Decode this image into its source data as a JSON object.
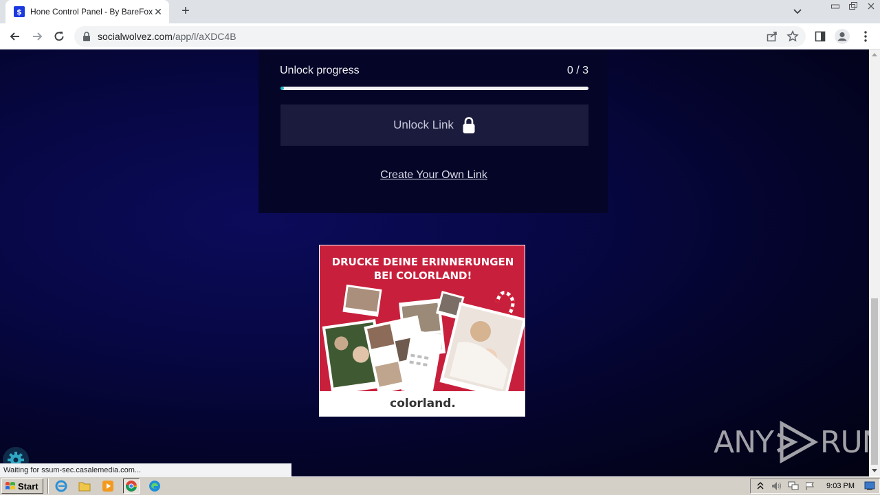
{
  "browser": {
    "tab": {
      "title": "Hone Control Panel - By BareFox",
      "favicon_glyph": "$"
    },
    "address": {
      "host": "socialwolvez.com",
      "path": "/app/l/aXDC4B"
    },
    "colors": {
      "tab_favicon": "#1a3ae0"
    }
  },
  "page": {
    "progress": {
      "label": "Unlock progress",
      "count": "0 / 3",
      "completed": 0,
      "total": 3
    },
    "unlock_button_label": "Unlock Link",
    "create_link_label": "Create Your Own Link",
    "ad": {
      "headline_line1": "DRUCKE DEINE ERINNERUNGEN",
      "headline_line2": "BEI COLORLAND!",
      "brand": "colorland."
    },
    "watermark_left": "ANY",
    "watermark_right": "RUN",
    "colors": {
      "background": "#04042a",
      "card": "#050528",
      "button": "#1b1b3d",
      "progress_fill": "#1fb5c8",
      "ad_red": "#c8203c"
    }
  },
  "status_bar": {
    "text": "Waiting for ssum-sec.casalemedia.com..."
  },
  "taskbar": {
    "start_label": "Start",
    "clock": "9:03 PM",
    "quick_launch": [
      "internet-explorer-icon",
      "folder-icon",
      "media-player-icon",
      "chrome-icon",
      "edge-icon"
    ]
  }
}
